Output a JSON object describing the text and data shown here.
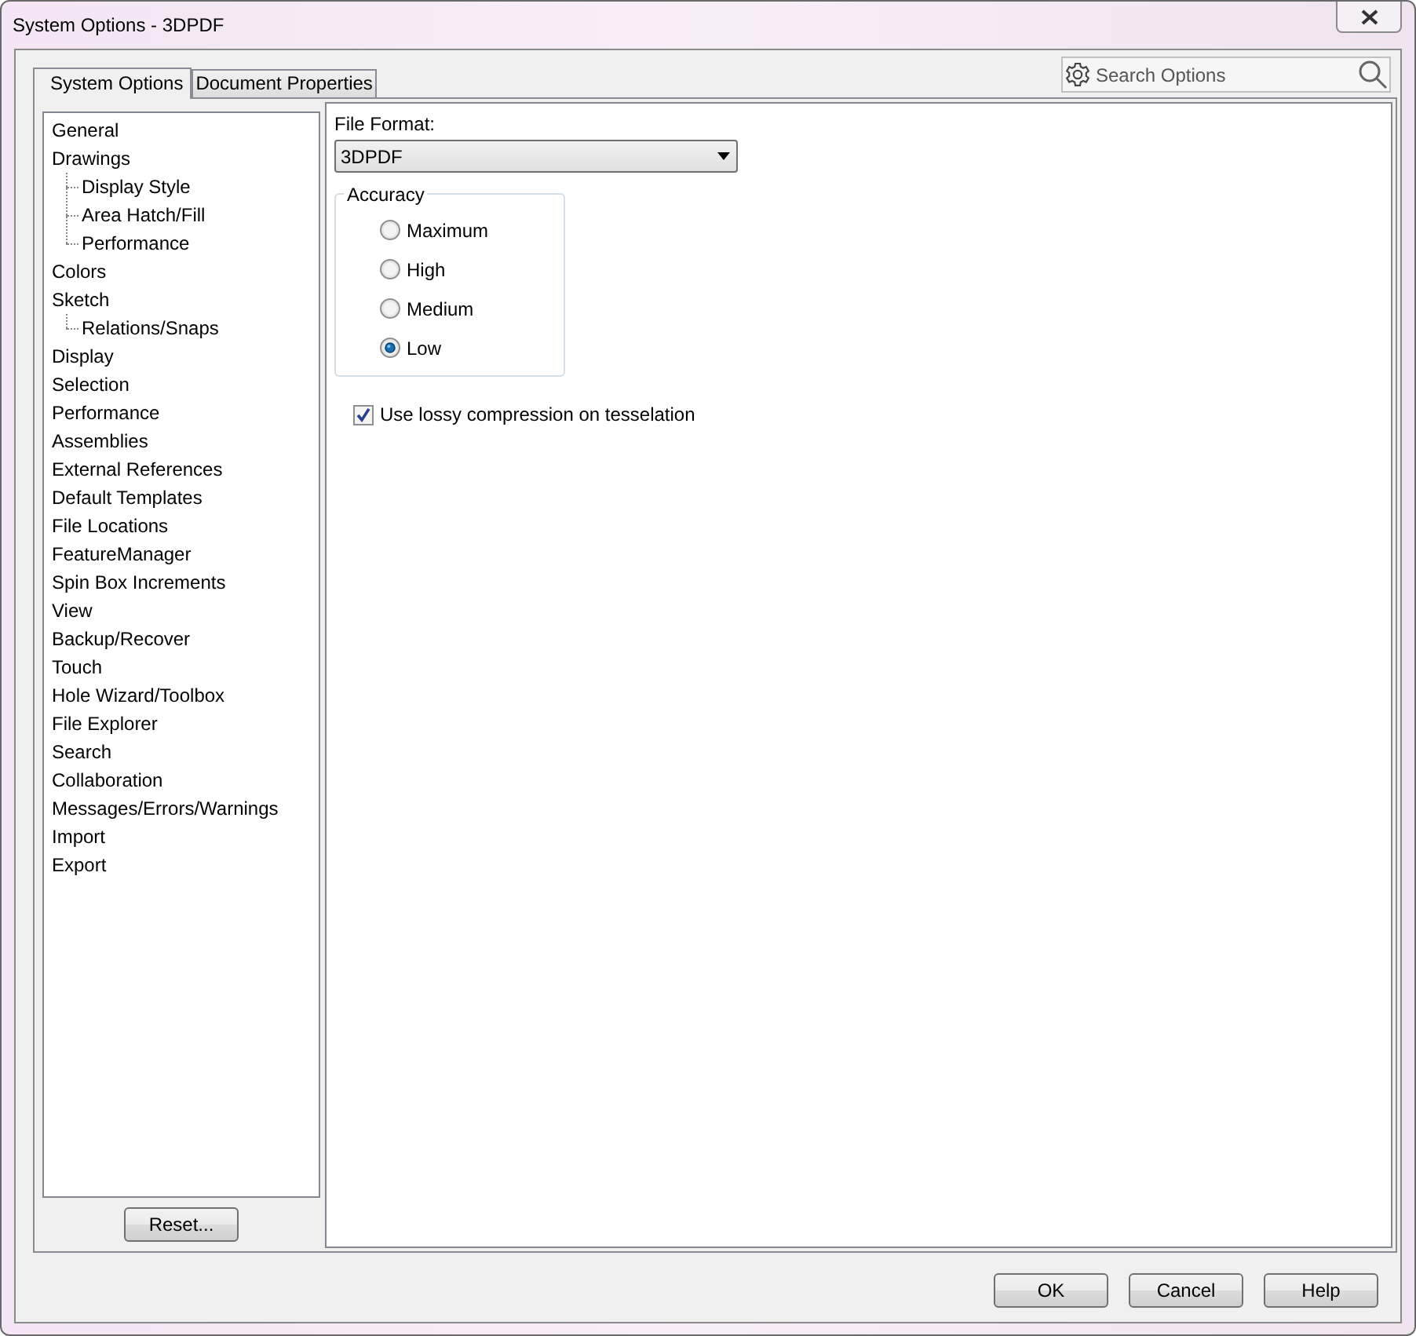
{
  "window": {
    "title": "System Options - 3DPDF"
  },
  "tabs": [
    {
      "label": "System Options",
      "selected": true
    },
    {
      "label": "Document Properties",
      "selected": false
    }
  ],
  "search": {
    "placeholder": "Search Options"
  },
  "tree": [
    {
      "label": "General"
    },
    {
      "label": "Drawings",
      "children": [
        {
          "label": "Display Style"
        },
        {
          "label": "Area Hatch/Fill"
        },
        {
          "label": "Performance"
        }
      ]
    },
    {
      "label": "Colors"
    },
    {
      "label": "Sketch",
      "children": [
        {
          "label": "Relations/Snaps"
        }
      ]
    },
    {
      "label": "Display"
    },
    {
      "label": "Selection"
    },
    {
      "label": "Performance"
    },
    {
      "label": "Assemblies"
    },
    {
      "label": "External References"
    },
    {
      "label": "Default Templates"
    },
    {
      "label": "File Locations"
    },
    {
      "label": "FeatureManager"
    },
    {
      "label": "Spin Box Increments"
    },
    {
      "label": "View"
    },
    {
      "label": "Backup/Recover"
    },
    {
      "label": "Touch"
    },
    {
      "label": "Hole Wizard/Toolbox"
    },
    {
      "label": "File Explorer"
    },
    {
      "label": "Search"
    },
    {
      "label": "Collaboration"
    },
    {
      "label": "Messages/Errors/Warnings"
    },
    {
      "label": "Import"
    },
    {
      "label": "Export"
    }
  ],
  "reset_button": "Reset...",
  "file_format": {
    "label": "File Format:",
    "value": "3DPDF"
  },
  "accuracy": {
    "title": "Accuracy",
    "options": [
      {
        "label": "Maximum",
        "selected": false
      },
      {
        "label": "High",
        "selected": false
      },
      {
        "label": "Medium",
        "selected": false
      },
      {
        "label": "Low",
        "selected": true
      }
    ]
  },
  "lossy_compression": {
    "label": "Use lossy compression on tesselation",
    "checked": true
  },
  "buttons": [
    "OK",
    "Cancel",
    "Help"
  ]
}
